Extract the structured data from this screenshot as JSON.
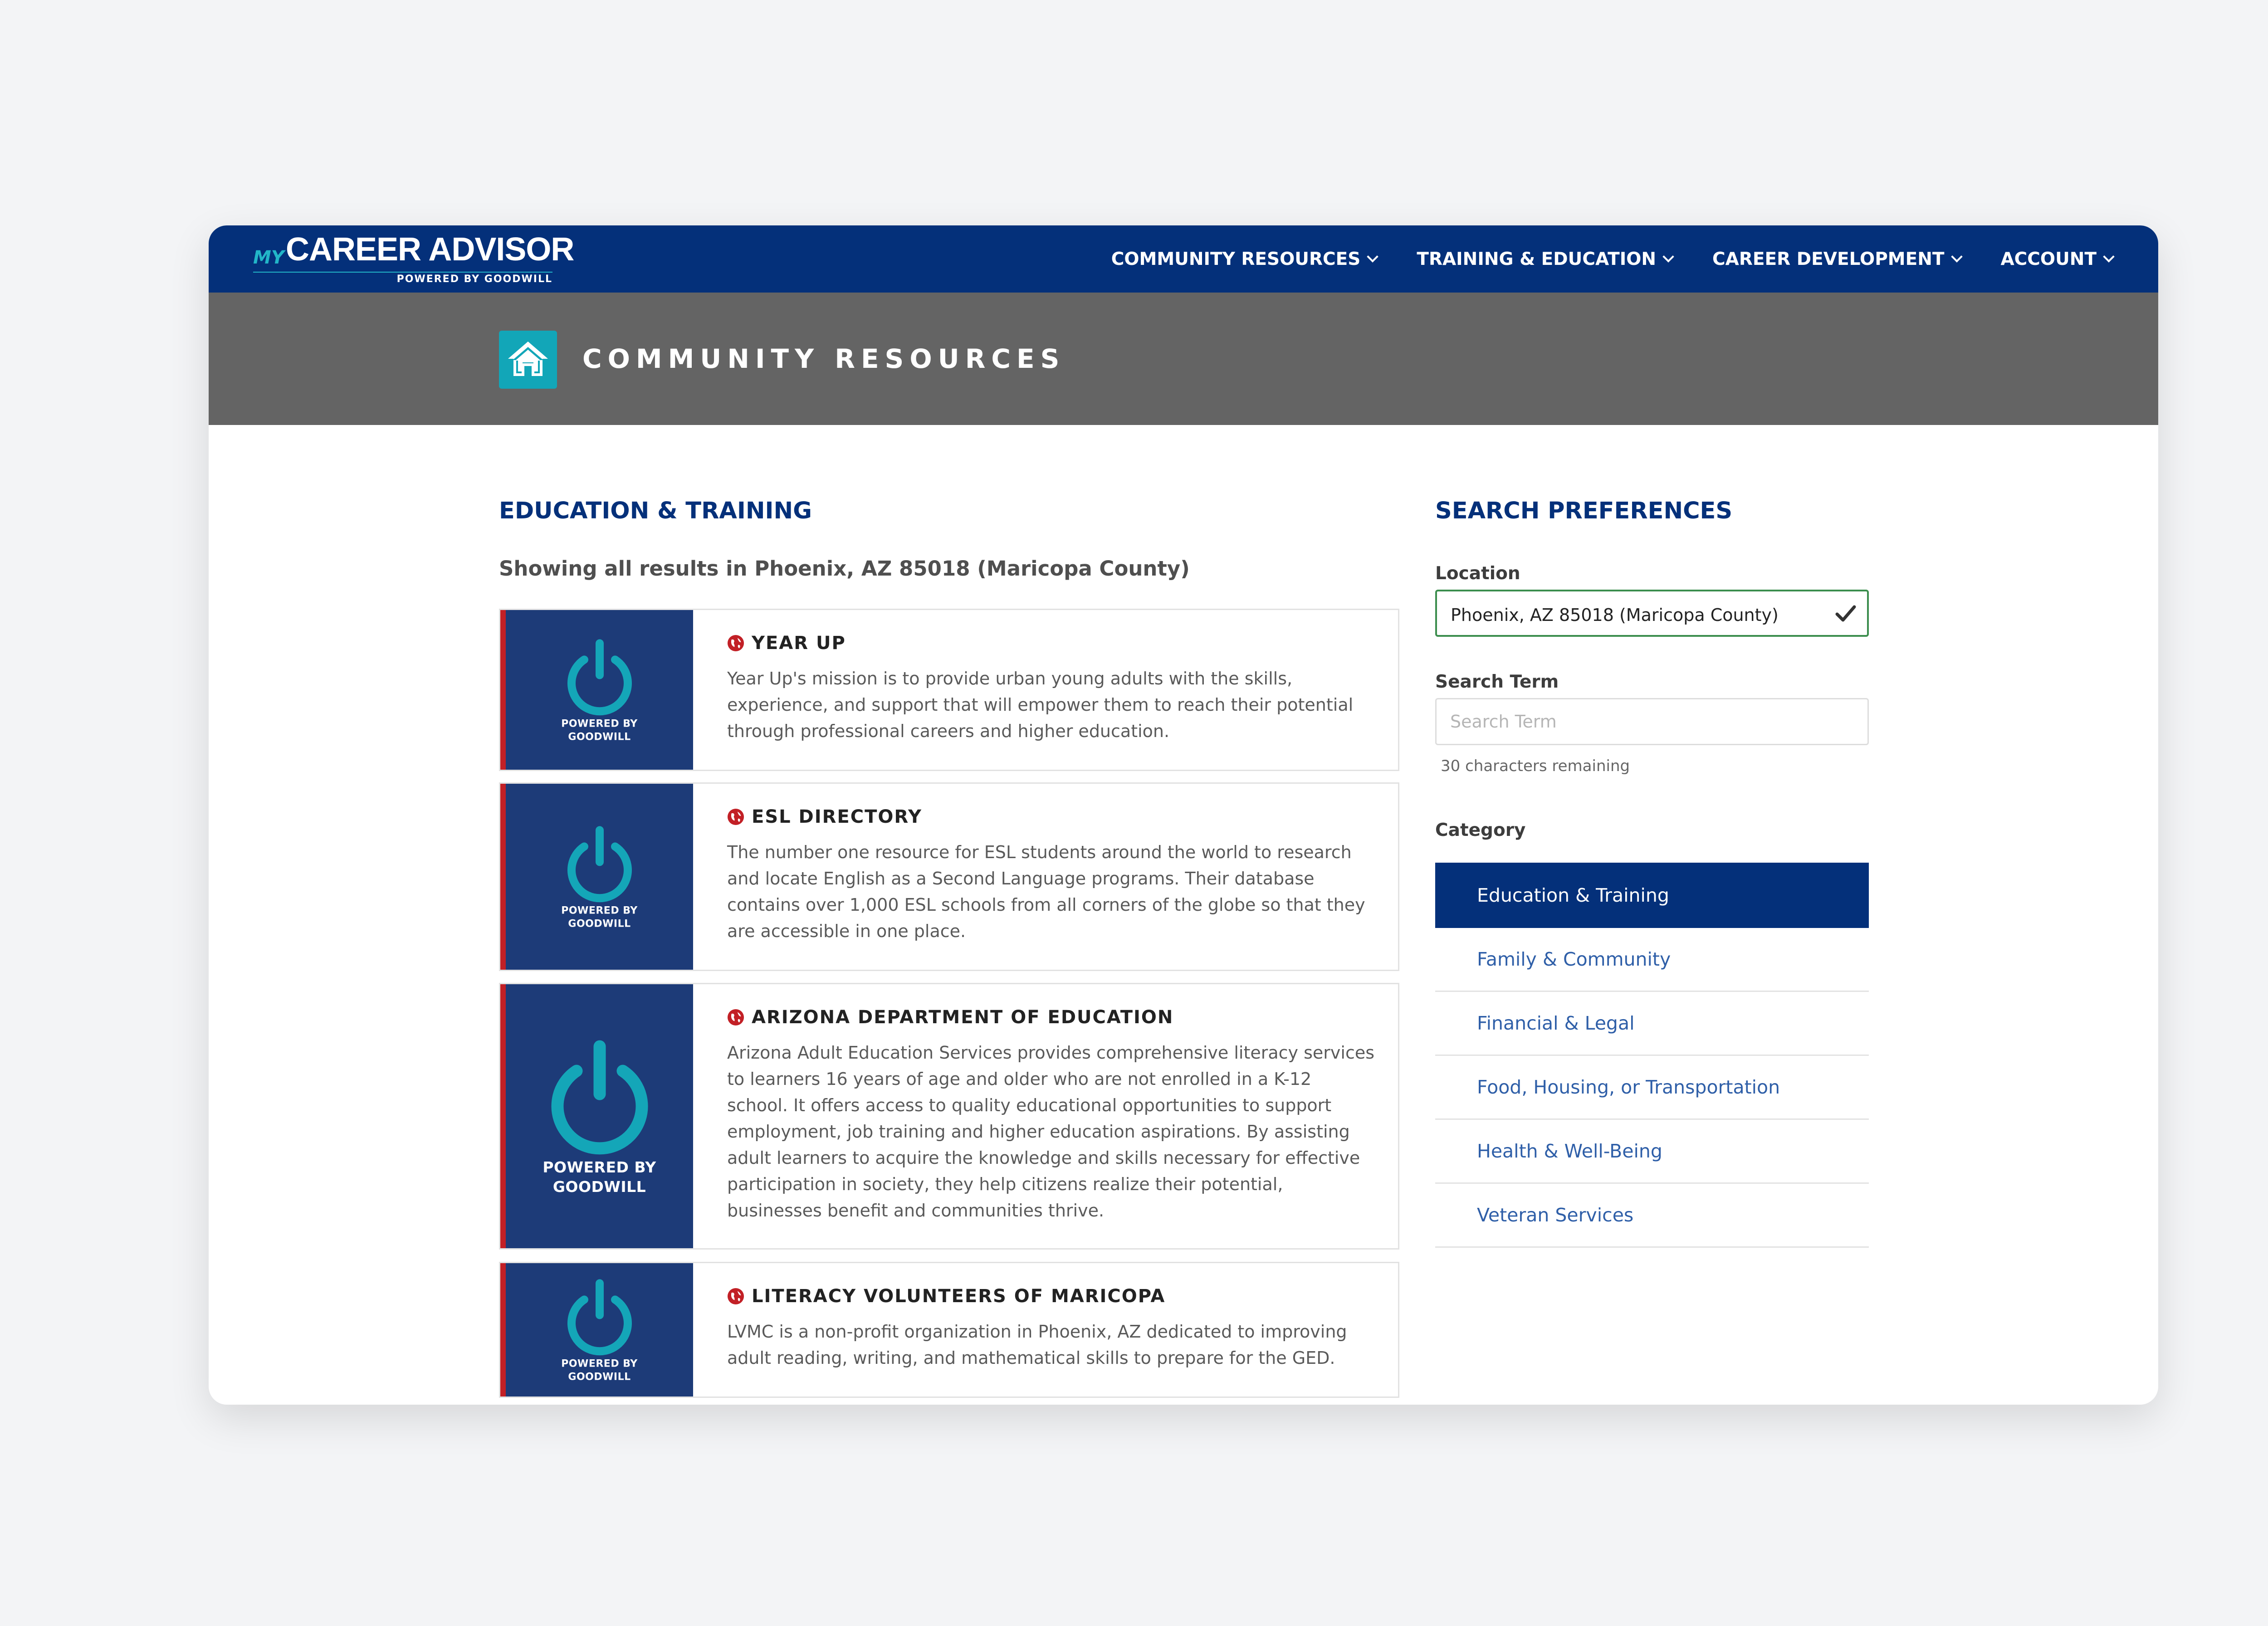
{
  "brand": {
    "my": "MY",
    "name": "CAREER ADVISOR",
    "tagline": "POWERED BY GOODWILL"
  },
  "nav": {
    "items": [
      {
        "label": "COMMUNITY RESOURCES",
        "icon": "chevron-down-icon"
      },
      {
        "label": "TRAINING & EDUCATION",
        "icon": "chevron-down-icon"
      },
      {
        "label": "CAREER DEVELOPMENT",
        "icon": "chevron-down-icon"
      },
      {
        "label": "ACCOUNT",
        "icon": "chevron-down-icon"
      }
    ]
  },
  "banner": {
    "title": "COMMUNITY RESOURCES",
    "icon": "house-icon"
  },
  "main": {
    "section_title": "EDUCATION & TRAINING",
    "results_summary": "Showing all results in Phoenix, AZ 85018 (Maricopa County)",
    "results": [
      {
        "title": "YEAR UP",
        "thumb_line1": "POWERED BY",
        "thumb_line2": "GOODWILL",
        "description": "Year Up's mission is to provide urban young adults with the skills, experience, and support that will empower them to reach their potential through professional careers and higher education."
      },
      {
        "title": "ESL DIRECTORY",
        "thumb_line1": "POWERED BY",
        "thumb_line2": "GOODWILL",
        "description": "The number one resource for ESL students around the world to research and locate English as a Second Language programs. Their database contains over 1,000 ESL schools from all corners of the globe so that they are accessible in one place."
      },
      {
        "title": "ARIZONA DEPARTMENT OF EDUCATION",
        "thumb_line1": "POWERED BY",
        "thumb_line2": "GOODWILL",
        "description": "Arizona Adult Education Services provides comprehensive literacy services to learners 16 years of age and older who are not enrolled in a K-12 school. It offers access to quality educational opportunities to support employment, job training and higher education aspirations. By assisting adult learners to acquire the knowledge and skills necessary for effective participation in society, they help citizens realize their potential, businesses benefit and communities thrive."
      },
      {
        "title": "LITERACY VOLUNTEERS OF MARICOPA",
        "thumb_line1": "POWERED BY",
        "thumb_line2": "GOODWILL",
        "description": "LVMC is a non-profit organization in Phoenix, AZ dedicated to improving adult reading, writing, and mathematical skills to prepare for the GED."
      }
    ]
  },
  "sidebar": {
    "title": "SEARCH PREFERENCES",
    "location_label": "Location",
    "location_value": "Phoenix, AZ 85018 (Maricopa County)",
    "search_label": "Search Term",
    "search_placeholder": "Search Term",
    "search_value": "",
    "char_remaining": "30 characters remaining",
    "category_label": "Category",
    "categories": [
      {
        "label": "Education & Training",
        "selected": true
      },
      {
        "label": "Family & Community",
        "selected": false
      },
      {
        "label": "Financial & Legal",
        "selected": false
      },
      {
        "label": "Food, Housing, or Transportation",
        "selected": false
      },
      {
        "label": "Health & Well-Being",
        "selected": false
      },
      {
        "label": "Veteran Services",
        "selected": false
      }
    ]
  },
  "colors": {
    "nav_bg": "#04307a",
    "banner_bg": "#646464",
    "accent_teal": "#12a6b8",
    "thumb_bg": "#1d3b78",
    "thumb_stripe": "#c22026",
    "link_blue": "#2f5fa8",
    "valid_green": "#3c8e4e"
  }
}
